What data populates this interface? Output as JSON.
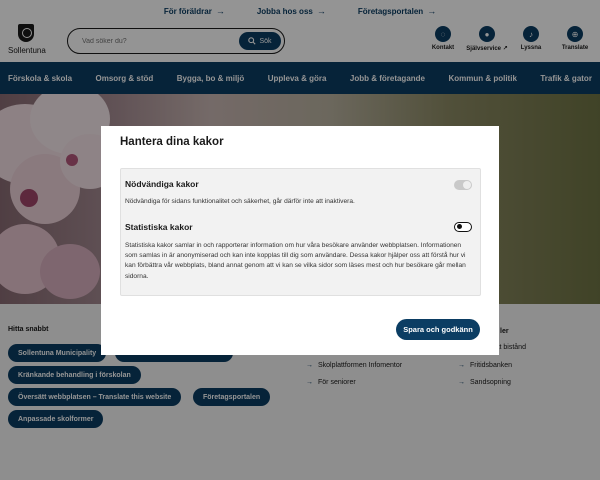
{
  "top_links": [
    {
      "label": "För föräldrar"
    },
    {
      "label": "Jobba hos oss"
    },
    {
      "label": "Företagsportalen"
    }
  ],
  "logo": {
    "name": "Sollentuna"
  },
  "search": {
    "placeholder": "Vad söker du?",
    "button_label": "Sök"
  },
  "header_icons": [
    {
      "label": "Kontakt",
      "icon": "chat-icon"
    },
    {
      "label": "Självservice",
      "icon": "person-icon"
    },
    {
      "label": "Lyssna",
      "icon": "listen-icon"
    },
    {
      "label": "Translate",
      "icon": "globe-icon"
    }
  ],
  "nav": [
    "Förskola & skola",
    "Omsorg & stöd",
    "Bygga, bo & miljö",
    "Uppleva & göra",
    "Jobb & företagande",
    "Kommun & politik",
    "Trafik & gator"
  ],
  "quick": {
    "heading": "Hitta snabbt",
    "pills": [
      "Sollentuna Municipality",
      "Kränkande behandling i förskolan",
      "Översätt webbplatsen – Translate this website",
      "Företagsportalen",
      "Anpassade skolformer"
    ]
  },
  "col_middle": [
    "Skolplattformen Infomentor",
    "För seniorer"
  ],
  "col_right": {
    "heading_fragment": "ler",
    "items": [
      "kt bistånd",
      "Fritidsbanken",
      "Sandsopning"
    ]
  },
  "modal": {
    "title": "Hantera dina kakor",
    "necessary": {
      "title": "Nödvändiga kakor",
      "description": "Nödvändiga för sidans funktionalitet och säkerhet, går därför inte att inaktivera."
    },
    "statistics": {
      "title": "Statistiska kakor",
      "description": "Statistiska kakor samlar in och rapporterar information om hur våra besökare använder webbplatsen. Informationen som samlas in är anonymiserad och kan inte kopplas till dig som användare. Dessa kakor hjälper oss att förstå hur vi kan förbättra vår webbplats, bland annat genom att vi kan se vilka sidor som läses mest och hur besökare går mellan sidorna."
    },
    "save_label": "Spara och godkänn"
  }
}
